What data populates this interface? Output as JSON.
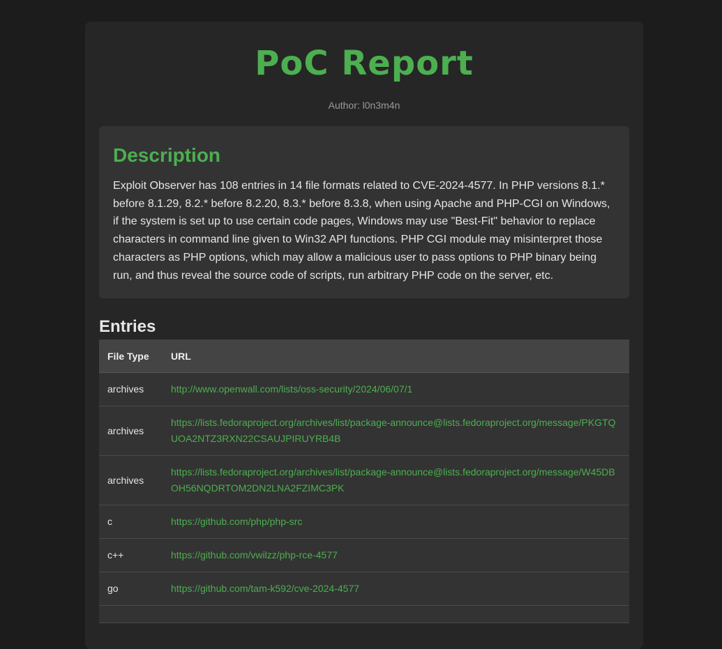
{
  "header": {
    "title": "PoC Report",
    "author_label": "Author: l0n3m4n"
  },
  "description": {
    "heading": "Description",
    "text": "Exploit Observer has 108 entries in 14 file formats related to CVE-2024-4577. In PHP versions 8.1.* before 8.1.29, 8.2.* before 8.2.20, 8.3.* before 8.3.8, when using Apache and PHP-CGI on Windows, if the system is set up to use certain code pages, Windows may use \"Best-Fit\" behavior to replace characters in command line given to Win32 API functions. PHP CGI module may misinterpret those characters as PHP options, which may allow a malicious user to pass options to PHP binary being run, and thus reveal the source code of scripts, run arbitrary PHP code on the server, etc."
  },
  "entries": {
    "heading": "Entries",
    "columns": [
      "File Type",
      "URL"
    ],
    "rows": [
      {
        "type": "archives",
        "url": "http://www.openwall.com/lists/oss-security/2024/06/07/1"
      },
      {
        "type": "archives",
        "url": "https://lists.fedoraproject.org/archives/list/package-announce@lists.fedoraproject.org/message/PKGTQUOA2NTZ3RXN22CSAUJPIRUYRB4B"
      },
      {
        "type": "archives",
        "url": "https://lists.fedoraproject.org/archives/list/package-announce@lists.fedoraproject.org/message/W45DBOH56NQDRTOM2DN2LNA2FZIMC3PK"
      },
      {
        "type": "c",
        "url": "https://github.com/php/php-src"
      },
      {
        "type": "c++",
        "url": "https://github.com/vwilzz/php-rce-4577"
      },
      {
        "type": "go",
        "url": "https://github.com/tam-k592/cve-2024-4577"
      },
      {
        "type": "",
        "url": ""
      }
    ]
  },
  "colors": {
    "background": "#1c1c1c",
    "panel": "#262626",
    "card": "#333333",
    "accent": "#4caf50"
  }
}
